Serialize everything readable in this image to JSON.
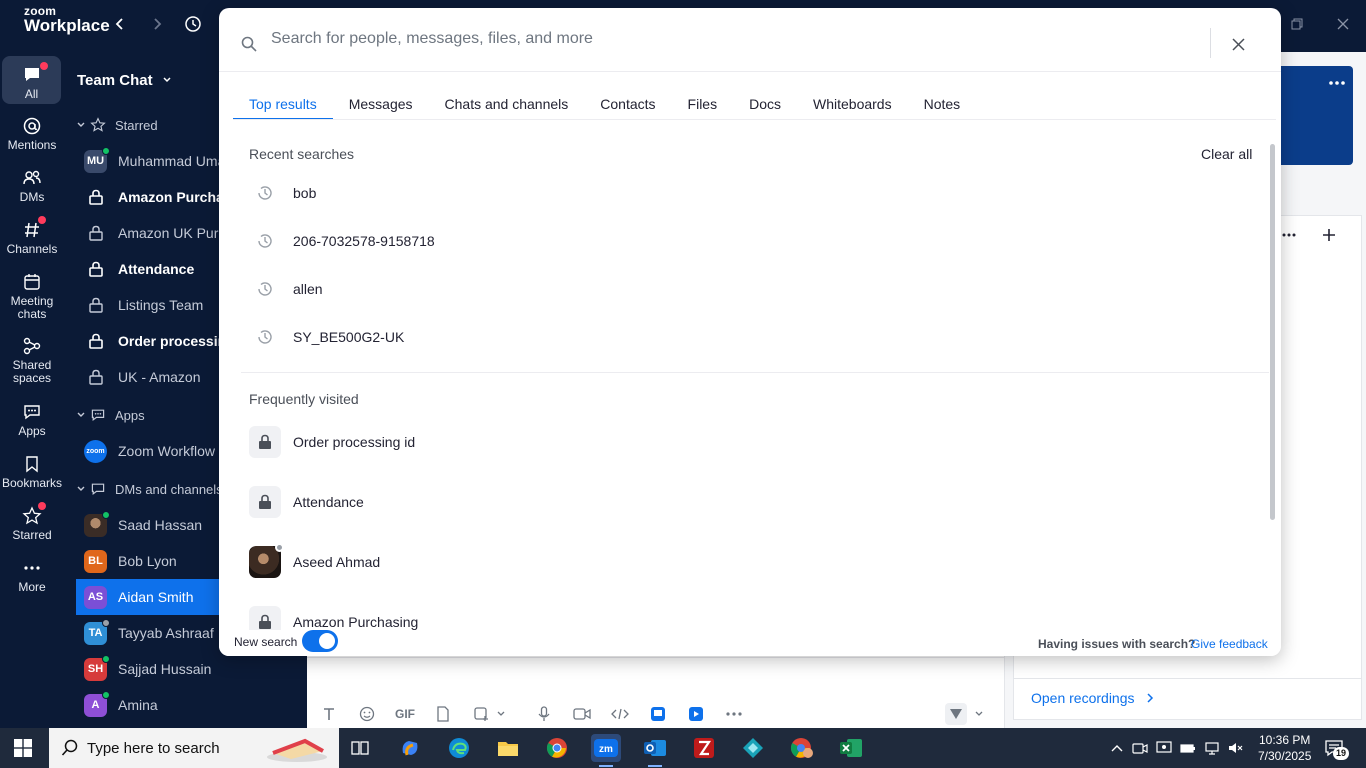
{
  "app": {
    "logo_line1": "zoom",
    "logo_line2": "Workplace"
  },
  "rail": [
    {
      "label": "All",
      "icon": "chat-icon"
    },
    {
      "label": "Mentions",
      "icon": "at-icon"
    },
    {
      "label": "DMs",
      "icon": "people-icon"
    },
    {
      "label": "Channels",
      "icon": "hash-icon"
    },
    {
      "label": "Meeting chats",
      "icon": "calendar-icon"
    },
    {
      "label": "Shared spaces",
      "icon": "share-icon"
    },
    {
      "label": "Apps",
      "icon": "apps-icon"
    },
    {
      "label": "Bookmarks",
      "icon": "bookmark-icon"
    },
    {
      "label": "Starred",
      "icon": "star-icon"
    },
    {
      "label": "More",
      "icon": "more-icon"
    }
  ],
  "sidebar": {
    "title": "Team Chat",
    "starred_label": "Starred",
    "starred": [
      {
        "name": "Muhammad Umar",
        "initials": "MU",
        "color": "#3a4a6b"
      },
      {
        "name": "Amazon Purchasing",
        "lock": true
      },
      {
        "name": "Amazon UK Purchasing",
        "lock": true
      },
      {
        "name": "Attendance",
        "lock": true
      },
      {
        "name": "Listings Team",
        "lock": true
      },
      {
        "name": "Order processing id",
        "lock": true
      },
      {
        "name": "UK - Amazon",
        "lock": true
      }
    ],
    "apps_label": "Apps",
    "apps": [
      {
        "name": "Zoom Workflow",
        "initials": "zoom",
        "color": "#0e71eb"
      }
    ],
    "dms_label": "DMs and channels",
    "dms": [
      {
        "name": "Saad Hassan",
        "initials": "",
        "color": "#4a3a32"
      },
      {
        "name": "Bob Lyon",
        "initials": "BL",
        "color": "#e0671b"
      },
      {
        "name": "Aidan Smith",
        "initials": "AS",
        "color": "#7b4fd6"
      },
      {
        "name": "Tayyab Ashraaf",
        "initials": "TA",
        "color": "#2f8fd6"
      },
      {
        "name": "Sajjad Hussain",
        "initials": "SH",
        "color": "#d63b3b"
      },
      {
        "name": "Amina",
        "initials": "A",
        "color": "#8e4fd6"
      }
    ]
  },
  "search": {
    "placeholder": "Search for people, messages, files, and more",
    "tabs": [
      "Top results",
      "Messages",
      "Chats and channels",
      "Contacts",
      "Files",
      "Docs",
      "Whiteboards",
      "Notes"
    ],
    "active_tab": "Top results",
    "recent_title": "Recent searches",
    "clear_all": "Clear all",
    "recent": [
      "bob",
      "206-7032578-9158718",
      "allen",
      "SY_BE500G2-UK"
    ],
    "frequent_title": "Frequently visited",
    "frequent": [
      {
        "name": "Order processing id",
        "type": "channel"
      },
      {
        "name": "Attendance",
        "type": "channel"
      },
      {
        "name": "Aseed Ahmad",
        "type": "person"
      },
      {
        "name": "Amazon Purchasing",
        "type": "channel"
      }
    ],
    "new_search_label": "New search",
    "new_search_on": true,
    "issues_text": "Having issues with search?",
    "feedback_link": "Give feedback"
  },
  "composer": {
    "gif_label": "GIF"
  },
  "right_panel": {
    "open_recordings": "Open recordings"
  },
  "taskbar": {
    "search_placeholder": "Type here to search",
    "time": "10:36 PM",
    "date": "7/30/2025",
    "notification_count": "19"
  },
  "colors": {
    "accent": "#0e71eb",
    "nav_bg": "#0b1a36",
    "presence": "#12c265"
  }
}
